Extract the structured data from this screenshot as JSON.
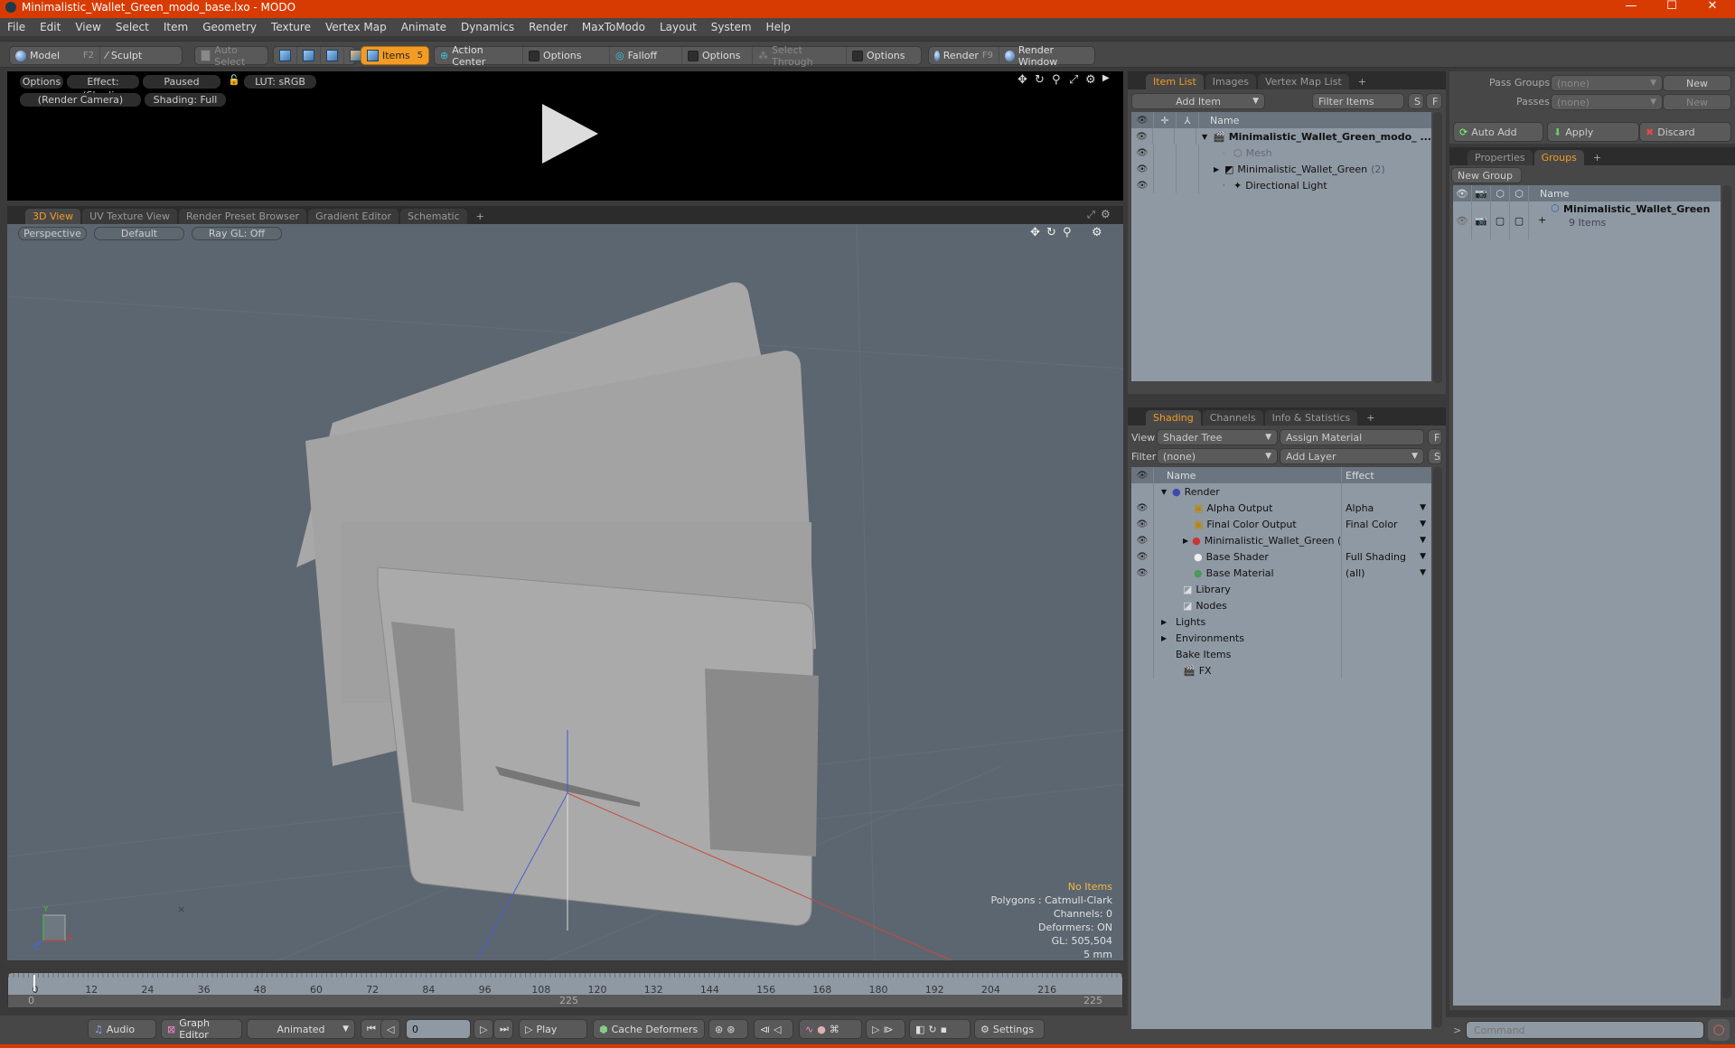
{
  "window": {
    "title": "Minimalistic_Wallet_Green_modo_base.lxo - MODO",
    "controls": [
      "minimize",
      "maximize",
      "close"
    ]
  },
  "menu": [
    "File",
    "Edit",
    "View",
    "Select",
    "Item",
    "Geometry",
    "Texture",
    "Vertex Map",
    "Animate",
    "Dynamics",
    "Render",
    "MaxToModo",
    "Layout",
    "System",
    "Help"
  ],
  "toolbar": {
    "model": "Model",
    "model_key": "F2",
    "sculpt": "Sculpt",
    "auto_select": "Auto Select",
    "items": "Items",
    "items_count": "5",
    "action_center": "Action Center",
    "options1": "Options",
    "falloff": "Falloff",
    "options2": "Options",
    "select_through": "Select Through",
    "options3": "Options",
    "render": "Render",
    "render_key": "F9",
    "render_window": "Render Window"
  },
  "render_view": {
    "options": "Options",
    "effect": "Effect: (Shadi...",
    "status": "Paused",
    "lut": "LUT: sRGB",
    "camera": "(Render Camera)",
    "shading": "Shading: Full"
  },
  "viewport_tabs": [
    {
      "label": "3D View",
      "selected": true
    },
    {
      "label": "UV Texture View"
    },
    {
      "label": "Render Preset Browser"
    },
    {
      "label": "Gradient Editor"
    },
    {
      "label": "Schematic"
    },
    {
      "label": "+"
    }
  ],
  "viewport": {
    "projection": "Perspective",
    "style": "Default",
    "raygl": "Ray GL: Off",
    "hud": {
      "selection": "No Items",
      "polygons": "Polygons : Catmull-Clark",
      "channels": "Channels: 0",
      "deformers": "Deformers: ON",
      "gl": "GL: 505,504",
      "grid": "5 mm"
    },
    "hud_highlight": "#f5b642",
    "axis": {
      "x": "X",
      "y": "Y",
      "z": "Z"
    }
  },
  "timeline": {
    "ticks": [
      "0",
      "12",
      "24",
      "36",
      "48",
      "60",
      "72",
      "84",
      "96",
      "108",
      "120",
      "132",
      "144",
      "156",
      "168",
      "180",
      "192",
      "204",
      "216"
    ],
    "start": "0",
    "mid": "225",
    "end": "225"
  },
  "transport": {
    "audio": "Audio",
    "graph_editor": "Graph Editor",
    "mode": "Animated",
    "frame": "0",
    "play": "Play",
    "cache_deformers": "Cache Deformers",
    "settings": "Settings"
  },
  "item_list": {
    "tabs": [
      {
        "label": "Item List",
        "selected": true
      },
      {
        "label": "Images"
      },
      {
        "label": "Vertex Map List"
      },
      {
        "label": "+"
      }
    ],
    "add_item": "Add Item",
    "filter": "Filter Items",
    "s": "S",
    "f": "F",
    "col_name": "Name",
    "rows": [
      {
        "name": "Minimalistic_Wallet_Green_modo_ ...",
        "bold": true,
        "indent": 0,
        "arrow": "▼",
        "icon": "scene-icon"
      },
      {
        "name": "Mesh",
        "dim": true,
        "indent": 2,
        "arrow": "",
        "icon": "mesh-icon"
      },
      {
        "name": "Minimalistic_Wallet_Green",
        "suffix": "(2)",
        "indent": 1,
        "arrow": "▶",
        "icon": "group-icon"
      },
      {
        "name": "Directional Light",
        "indent": 2,
        "arrow": "",
        "icon": "light-icon"
      }
    ]
  },
  "shading": {
    "tabs": [
      {
        "label": "Shading",
        "selected": true
      },
      {
        "label": "Channels"
      },
      {
        "label": "Info & Statistics"
      },
      {
        "label": "+"
      }
    ],
    "view_label": "View",
    "view_value": "Shader Tree",
    "assign_material": "Assign Material",
    "f": "F",
    "filter_label": "Filter",
    "filter_value": "(none)",
    "add_layer": "Add Layer",
    "s": "S",
    "col_name": "Name",
    "col_effect": "Effect",
    "rows": [
      {
        "name": "Render",
        "effect": "",
        "eye": false,
        "indent": 0,
        "arrow": "▼",
        "icon": "render-icon"
      },
      {
        "name": "Alpha Output",
        "effect": "Alpha",
        "eye": true,
        "indent": 1,
        "icon": "output-icon"
      },
      {
        "name": "Final Color Output",
        "effect": "Final Color",
        "eye": true,
        "indent": 1,
        "icon": "output-icon"
      },
      {
        "name": "Minimalistic_Wallet_Green ( ...",
        "effect": "",
        "eye": true,
        "indent": 1,
        "arrow": "▶",
        "icon": "material-group-icon"
      },
      {
        "name": "Base Shader",
        "effect": "Full Shading",
        "eye": true,
        "indent": 1,
        "icon": "shader-icon"
      },
      {
        "name": "Base Material",
        "effect": "(all)",
        "eye": true,
        "indent": 1,
        "icon": "material-icon"
      },
      {
        "name": "Library",
        "indent": 0.5,
        "icon": "folder-icon"
      },
      {
        "name": "Nodes",
        "indent": 0.5,
        "icon": "folder-icon"
      },
      {
        "name": "Lights",
        "indent": 0,
        "arrow": "▶"
      },
      {
        "name": "Environments",
        "indent": 0,
        "arrow": "▶"
      },
      {
        "name": "Bake Items",
        "indent": 0
      },
      {
        "name": "FX",
        "indent": 0.5,
        "icon": "fx-icon"
      }
    ]
  },
  "passes": {
    "pass_groups_label": "Pass Groups",
    "pass_groups_value": "(none)",
    "passes_label": "Passes",
    "passes_value": "(none)",
    "new": "New",
    "auto_add": "Auto Add",
    "apply": "Apply",
    "discard": "Discard"
  },
  "groups": {
    "tabs": [
      {
        "label": "Properties"
      },
      {
        "label": "Groups",
        "selected": true
      },
      {
        "label": "+"
      }
    ],
    "new_group": "New Group",
    "col_name": "Name",
    "rows": [
      {
        "name": "Minimalistic_Wallet_Green",
        "sub": "9 Items"
      }
    ]
  },
  "command": {
    "placeholder": "Command",
    "prompt": ">"
  },
  "colors": {
    "accent": "#f39b23",
    "titlebar": "#d83b01",
    "viewport": "#5c6670",
    "list": "#8f99a3"
  }
}
